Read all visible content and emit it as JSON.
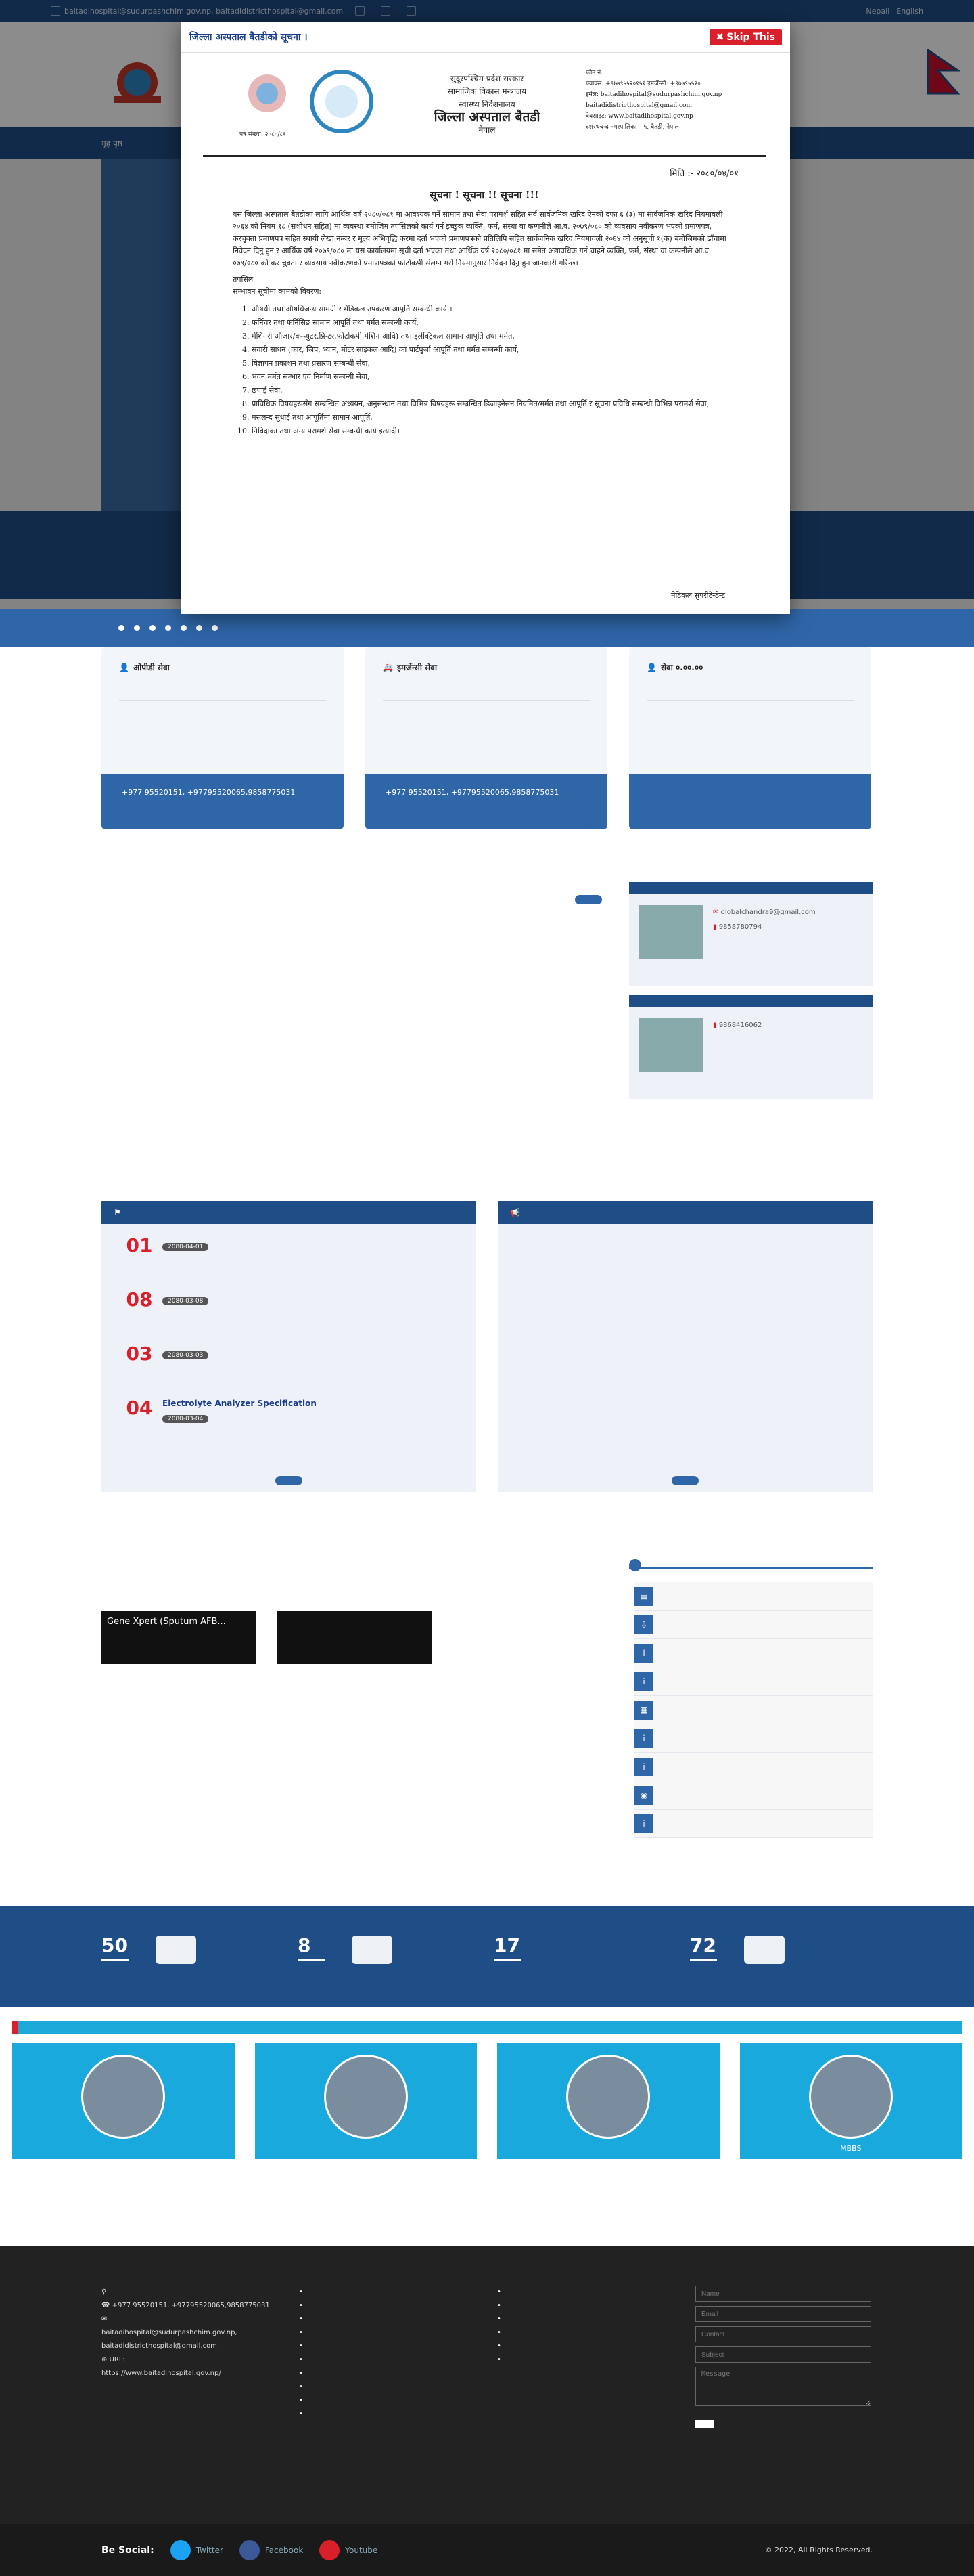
{
  "topbar": {
    "email": "baitadihospital@sudurpashchim.gov.np, baitadidistricthospital@gmail.com",
    "item2": "",
    "item3": "",
    "item4": "",
    "lang1": "Nepali",
    "lang2": "English"
  },
  "nav": [
    "गृह पृष्ठ",
    "",
    "",
    "",
    "",
    "",
    "",
    ""
  ],
  "modal": {
    "title": "जिल्ला अस्पताल बैतडीको सूचना ।",
    "skip": "Skip This",
    "letter": {
      "head_lines": [
        "सुदूरपश्चिम प्रदेश सरकार",
        "सामाजिक विकास मन्त्रालय",
        "स्वास्थ्य निर्देशनालय"
      ],
      "org": "जिल्ला अस्पताल बैतडी",
      "country": "नेपाल",
      "ref": "पत्र संख्या: २०८०/८१",
      "contact": [
        "फोन नं.",
        "फ्याक्स: +९७७९५५२०१५१  इमर्जेन्सी: +९७७९५५२०",
        "इमेल: baitadihospital@sudurpashchim.gov.np",
        "baitadidistricthospital@gmail.com",
        "वेबसाइट: www.baitadihospital.gov.np",
        "दशरथचन्द नगरपालिका – ५, बैतडी, नेपाल"
      ],
      "date": "मिति :- २०८०/०४/०१",
      "subject": "सूचना ! सूचना !! सूचना !!!",
      "para": "यस जिल्ला अस्पताल बैतडीका लागि आर्थिक वर्ष २०८०/०८१ मा आवश्यक पर्ने सामान तथा सेवा,परामर्श सहित सर्व सार्वजनिक खरिद ऐनको दफा ६ (३) मा सार्वजनिक खरिद नियमावली २०६४ को नियम १८ (संशोधन सहित) मा व्यवस्था बमोजिम तपसिलको कार्य गर्न इच्छुक व्यक्ति, फर्म, संस्था वा कम्पनीले आ.व. २०७९/०८० को व्यवसाय नवीकरण भएको प्रमाणपत्र, करचुक्ता प्रमाणपत्र सहित स्थायी लेखा नम्बर र मूल्य अभिवृद्धि करमा दर्ता भएको प्रमाणपत्रको प्रतिलिपि सहित सार्वजनिक खरिद नियमावली २०६४ को अनुसूची १(क) बमोजिमको ढाँचामा निवेदन दिनु हुन र आर्थिक वर्ष २०७९/०८० मा यस कार्यालयमा सूची दर्ता भएका तथा आर्थिक वर्ष २०८०/०८१ मा समेत अद्यावधिक गर्न चाहने व्यक्ति, फर्म, संस्था वा कम्पनीले आ.व. ०७९/०८० को कर चुक्ता र व्यवसाय नवीकरणको प्रमाणपत्रको फोटोकपी संलग्न गरी नियमानुसार निवेदन दिनु हुन जानकारी गरिन्छ।",
      "tapsil": "तपसिल",
      "list_head": "सम्भावन सूचीमा कामको विवरण:",
      "items": [
        "औषधी तथा औषधिजन्य सामग्री र मेडिकल उपकरण आपूर्ति सम्बन्धी कार्य ।",
        "फर्निचर तथा फर्निसिङ सामान आपूर्ति तथा मर्मत सम्बन्धी कार्य,",
        "मेशिनरी औजार/कम्प्युटर,प्रिन्टर,फोटोकपी,मेशिन आदि) तथा इलेक्ट्रिकल सामान आपूर्ति तथा मर्मत,",
        "सवारी साधन (कार, जिप, भ्यान, मोटर साइकल आदि) का पार्टपुर्जा आपूर्ति तथा मर्मत सम्बन्धी कार्य,",
        "विज्ञापन प्रकाशन तथा प्रसारण सम्बन्धी सेवा,",
        "भवन मर्मत सम्भार एवं निर्माण सम्बन्धी सेवा,",
        "छपाई सेवा,",
        "प्राविधिक विषयहरूसँग सम्बन्धित अध्ययन, अनुसन्धान तथा विभिन्न विषयहरू सम्बन्धित डिजाइनेसन नियमित/मर्मत तथा आपूर्ति र सूचना प्रविधि सम्बन्धी विभिन्न परामर्श सेवा,",
        "मसलन्द सुधाई तथा आपूर्तिमा सामान आपूर्ति,",
        "निविदाका तथा अन्य परामर्श सेवा सम्बन्धी कार्य इत्यादी।"
      ],
      "sign": "मेडिकल सुपरीटेन्डेन्ट"
    }
  },
  "cards": [
    {
      "title": "ओपीडी सेवा",
      "lines": [
        "",
        ""
      ],
      "footer": "",
      "phones": ""
    },
    {
      "title": "इमर्जेन्सी सेवा",
      "lines": [
        "",
        ""
      ],
      "footer": "",
      "phones": "+977 95520151, +9779552006, 9858775031"
    },
    {
      "title": "सेवा ०.००.००",
      "lines": [
        "",
        ""
      ],
      "footer": "",
      "phones": ""
    }
  ],
  "card_footer_phones": "+977 95520151, +97795520065,9858775031",
  "about": {
    "title_plain": "",
    "title_red": "",
    "text": "",
    "more": "",
    "btn": ""
  },
  "officers": [
    {
      "heading": "",
      "name": "",
      "post": "",
      "email": "dlobalchandra9@gmail.com",
      "phone": "9858780794"
    },
    {
      "heading": "",
      "name": "",
      "post": "",
      "email": "",
      "phone": "9868416062"
    }
  ],
  "news": {
    "title_plain": "",
    "title_red": "",
    "col1_title": "",
    "col2_title": "",
    "items": [
      {
        "day": "01",
        "month": "",
        "title": "",
        "date": "2080-04-01"
      },
      {
        "day": "08",
        "month": "",
        "title": "",
        "date": "2080-03-08"
      },
      {
        "day": "03",
        "month": "",
        "title": "",
        "date": "2080-03-03"
      },
      {
        "day": "04",
        "month": "",
        "title": "Electrolyte Analyzer Specification",
        "date": "2080-03-04"
      }
    ],
    "btn1": "",
    "btn2": ""
  },
  "gallery": {
    "title_plain": "",
    "title_red": "",
    "items": [
      "Gene Xpert (Sputum AFB...",
      ""
    ]
  },
  "links": {
    "title": "",
    "items": [
      "",
      "",
      "",
      "",
      "",
      "",
      "",
      "",
      ""
    ]
  },
  "stats": [
    {
      "num": "50",
      "label": ""
    },
    {
      "num": "8",
      "label": ""
    },
    {
      "num": "17",
      "label": ""
    },
    {
      "num": "72",
      "label": ""
    }
  ],
  "staff": {
    "title": "",
    "people": [
      {
        "name": "",
        "degree": ""
      },
      {
        "name": "",
        "degree": ""
      },
      {
        "name": "",
        "degree": ""
      },
      {
        "name": "",
        "degree": "MBBS"
      }
    ]
  },
  "footer": {
    "org": "",
    "address": "",
    "phone": "+977 95520151, +97795520065,9858775031",
    "email_label": "",
    "email": "baitadihospital@sudurpashchim.gov.np, baitadidistricthospital@gmail.com",
    "url_label": "URL:",
    "url": "https://www.baitadihospital.gov.np/",
    "col2_title": "",
    "col2_items": [
      "",
      "",
      "",
      "",
      "",
      "",
      "",
      "",
      "",
      ""
    ],
    "col3_title": "",
    "col3_items": [
      "",
      "",
      "",
      "",
      "",
      ""
    ],
    "col4_title": "",
    "form": {
      "name": "Name",
      "email": "Email",
      "contact": "Contact",
      "subject": "Subject",
      "message": "Message",
      "submit": ""
    }
  },
  "bottom": {
    "be_social": "Be Social:",
    "twitter": "Twitter",
    "facebook": "Facebook",
    "youtube": "Youtube",
    "copyright": "© 2022, All Rights Reserved."
  }
}
